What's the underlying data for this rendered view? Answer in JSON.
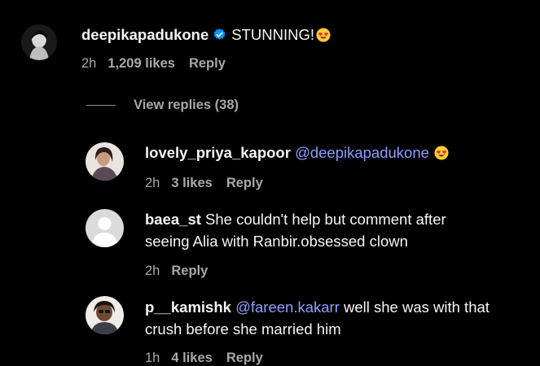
{
  "comments": [
    {
      "username": "deepikapadukone",
      "verified": true,
      "text": "STUNNING!",
      "emoji": "heart-eyes-emoji",
      "time": "2h",
      "likes": "1,209 likes",
      "reply": "Reply"
    }
  ],
  "view_replies": "View replies (38)",
  "replies": [
    {
      "username": "lovely_priya_kapoor",
      "mention": "@deepikapadukone",
      "emoji": "heart-eyes-emoji",
      "time": "2h",
      "likes": "3 likes",
      "reply": "Reply"
    },
    {
      "username": "baea_st",
      "text_line1": "She couldn't help but comment after",
      "text_line2": "seeing Alia with Ranbir.obsessed clown",
      "time": "2h",
      "reply": "Reply"
    },
    {
      "username": "p__kamishk",
      "mention": "@fareen.kakarr",
      "text_line1": "well she was with that",
      "text_line2": "crush before she married him",
      "time": "1h",
      "likes": "4 likes",
      "reply": "Reply"
    }
  ],
  "colors": {
    "background": "#000000",
    "text": "#f5f5f5",
    "secondary": "#a8a8a8",
    "mention": "#8f9eff",
    "verified": "#0095f6"
  }
}
